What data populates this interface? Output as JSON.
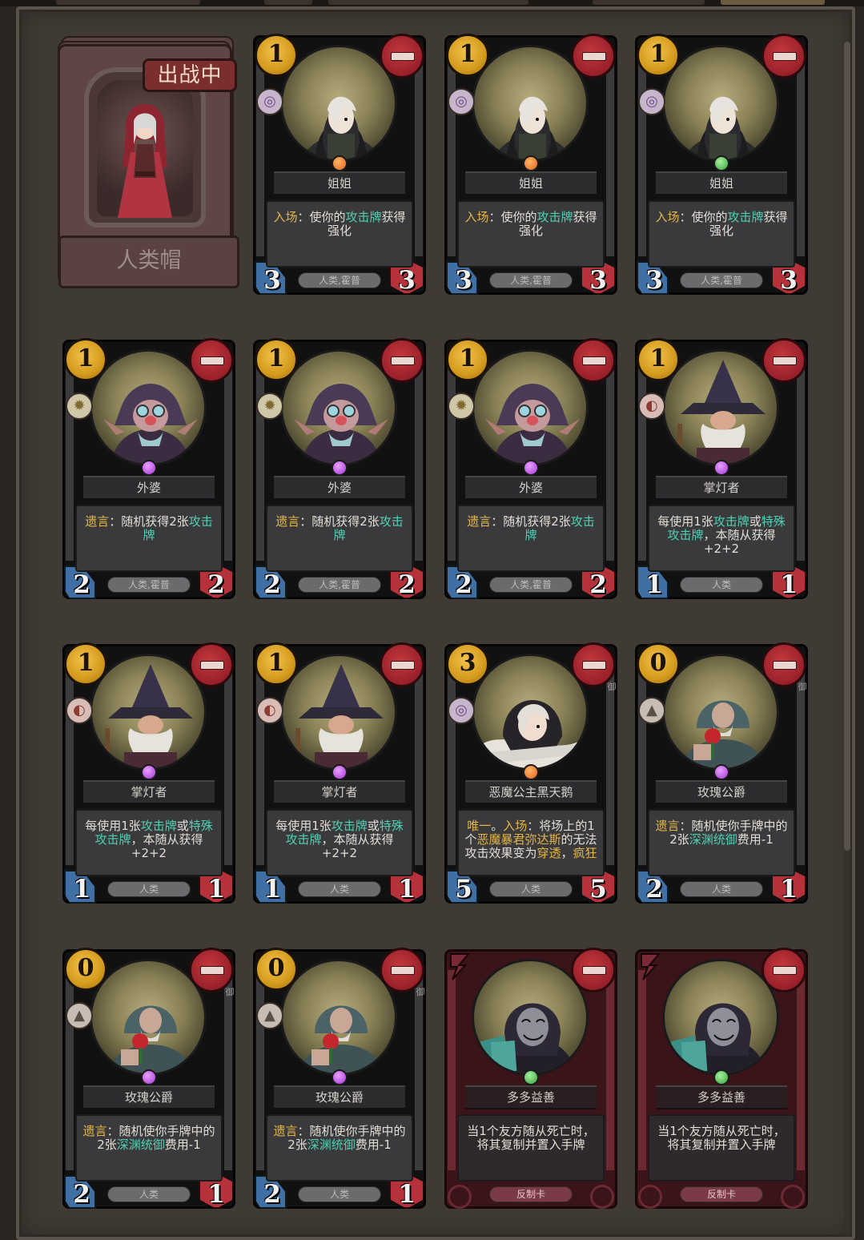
{
  "hero": {
    "badge": "出战中",
    "name": "人类帽"
  },
  "cards": [
    {
      "cost": "1",
      "name": "姐姐",
      "faction": "void",
      "jewel": "orange",
      "desc": [
        {
          "t": "入场",
          "c": "kw"
        },
        {
          "t": "：使你的"
        },
        {
          "t": "攻击牌",
          "c": "hl"
        },
        {
          "t": "获得强化"
        }
      ],
      "tag": "人类,霍普",
      "atk": "3",
      "hp": "3",
      "art": "girl"
    },
    {
      "cost": "1",
      "name": "姐姐",
      "faction": "void",
      "jewel": "orange",
      "desc": [
        {
          "t": "入场",
          "c": "kw"
        },
        {
          "t": "：使你的"
        },
        {
          "t": "攻击牌",
          "c": "hl"
        },
        {
          "t": "获得强化"
        }
      ],
      "tag": "人类,霍普",
      "atk": "3",
      "hp": "3",
      "art": "girl"
    },
    {
      "cost": "1",
      "name": "姐姐",
      "faction": "void",
      "jewel": "green",
      "desc": [
        {
          "t": "入场",
          "c": "kw"
        },
        {
          "t": "：使你的"
        },
        {
          "t": "攻击牌",
          "c": "hl"
        },
        {
          "t": "获得强化"
        }
      ],
      "tag": "人类,霍普",
      "atk": "3",
      "hp": "3",
      "art": "girl"
    },
    {
      "cost": "1",
      "name": "外婆",
      "faction": "sun",
      "jewel": "purple",
      "desc": [
        {
          "t": "遗言",
          "c": "kw"
        },
        {
          "t": "：随机获得2张"
        },
        {
          "t": "攻击牌",
          "c": "hl"
        }
      ],
      "tag": "人类,霍普",
      "atk": "2",
      "hp": "2",
      "art": "granny"
    },
    {
      "cost": "1",
      "name": "外婆",
      "faction": "sun",
      "jewel": "purple",
      "desc": [
        {
          "t": "遗言",
          "c": "kw"
        },
        {
          "t": "：随机获得2张"
        },
        {
          "t": "攻击牌",
          "c": "hl"
        }
      ],
      "tag": "人类,霍普",
      "atk": "2",
      "hp": "2",
      "art": "granny"
    },
    {
      "cost": "1",
      "name": "外婆",
      "faction": "sun",
      "jewel": "purple",
      "desc": [
        {
          "t": "遗言",
          "c": "kw"
        },
        {
          "t": "：随机获得2张"
        },
        {
          "t": "攻击牌",
          "c": "hl"
        }
      ],
      "tag": "人类,霍普",
      "atk": "2",
      "hp": "2",
      "art": "granny"
    },
    {
      "cost": "1",
      "name": "掌灯者",
      "faction": "fire",
      "jewel": "purple",
      "desc": [
        {
          "t": "每使用1张"
        },
        {
          "t": "攻击牌",
          "c": "hl"
        },
        {
          "t": "或"
        },
        {
          "t": "特殊攻击牌",
          "c": "hl"
        },
        {
          "t": "，本随从获得+2+2"
        }
      ],
      "tag": "人类",
      "atk": "1",
      "hp": "1",
      "art": "wizard"
    },
    {
      "cost": "1",
      "name": "掌灯者",
      "faction": "fire",
      "jewel": "purple",
      "desc": [
        {
          "t": "每使用1张"
        },
        {
          "t": "攻击牌",
          "c": "hl"
        },
        {
          "t": "或"
        },
        {
          "t": "特殊攻击牌",
          "c": "hl"
        },
        {
          "t": "，本随从获得+2+2"
        }
      ],
      "tag": "人类",
      "atk": "1",
      "hp": "1",
      "art": "wizard"
    },
    {
      "cost": "1",
      "name": "掌灯者",
      "faction": "fire",
      "jewel": "purple",
      "desc": [
        {
          "t": "每使用1张"
        },
        {
          "t": "攻击牌",
          "c": "hl"
        },
        {
          "t": "或"
        },
        {
          "t": "特殊攻击牌",
          "c": "hl"
        },
        {
          "t": "，本随从获得+2+2"
        }
      ],
      "tag": "人类",
      "atk": "1",
      "hp": "1",
      "art": "wizard"
    },
    {
      "cost": "3",
      "name": "恶魔公主黑天鹅",
      "faction": "void",
      "jewel": "orange",
      "desc": [
        {
          "t": "唯一",
          "c": "kw"
        },
        {
          "t": "。"
        },
        {
          "t": "入场",
          "c": "kw"
        },
        {
          "t": "：将场上的1个"
        },
        {
          "t": "恶魔暴君弥达斯",
          "c": "kw"
        },
        {
          "t": "的无法攻击效果变为"
        },
        {
          "t": "穿透",
          "c": "kw"
        },
        {
          "t": "，"
        },
        {
          "t": "疯狂",
          "c": "kw"
        }
      ],
      "tag": "人类",
      "atk": "5",
      "hp": "5",
      "art": "princess",
      "side": "御"
    },
    {
      "cost": "0",
      "name": "玫瑰公爵",
      "faction": "mount",
      "jewel": "purple",
      "desc": [
        {
          "t": "遗言",
          "c": "kw"
        },
        {
          "t": "：随机使你手牌中的2张"
        },
        {
          "t": "深渊统御",
          "c": "hl"
        },
        {
          "t": "费用-1"
        }
      ],
      "tag": "人类",
      "atk": "2",
      "hp": "1",
      "art": "duke",
      "side": "御"
    },
    {
      "cost": "0",
      "name": "玫瑰公爵",
      "faction": "mount",
      "jewel": "purple",
      "desc": [
        {
          "t": "遗言",
          "c": "kw"
        },
        {
          "t": "：随机使你手牌中的2张"
        },
        {
          "t": "深渊统御",
          "c": "hl"
        },
        {
          "t": "费用-1"
        }
      ],
      "tag": "人类",
      "atk": "2",
      "hp": "1",
      "art": "duke",
      "side": "御"
    },
    {
      "cost": "0",
      "name": "玫瑰公爵",
      "faction": "mount",
      "jewel": "purple",
      "desc": [
        {
          "t": "遗言",
          "c": "kw"
        },
        {
          "t": "：随机使你手牌中的2张"
        },
        {
          "t": "深渊统御",
          "c": "hl"
        },
        {
          "t": "费用-1"
        }
      ],
      "tag": "人类",
      "atk": "2",
      "hp": "1",
      "art": "duke",
      "side": "御"
    },
    {
      "counter": true,
      "name": "多多益善",
      "jewel": "green",
      "desc": [
        {
          "t": "当1个友方随从死亡时，将其复制并置入手牌"
        }
      ],
      "tag": "反制卡",
      "art": "masked"
    },
    {
      "counter": true,
      "name": "多多益善",
      "jewel": "green",
      "desc": [
        {
          "t": "当1个友方随从死亡时，将其复制并置入手牌"
        }
      ],
      "tag": "反制卡",
      "art": "masked"
    }
  ],
  "colors": {
    "keyword": "#e3b546",
    "highlight": "#4fd0b3",
    "panel": "#403a34"
  }
}
